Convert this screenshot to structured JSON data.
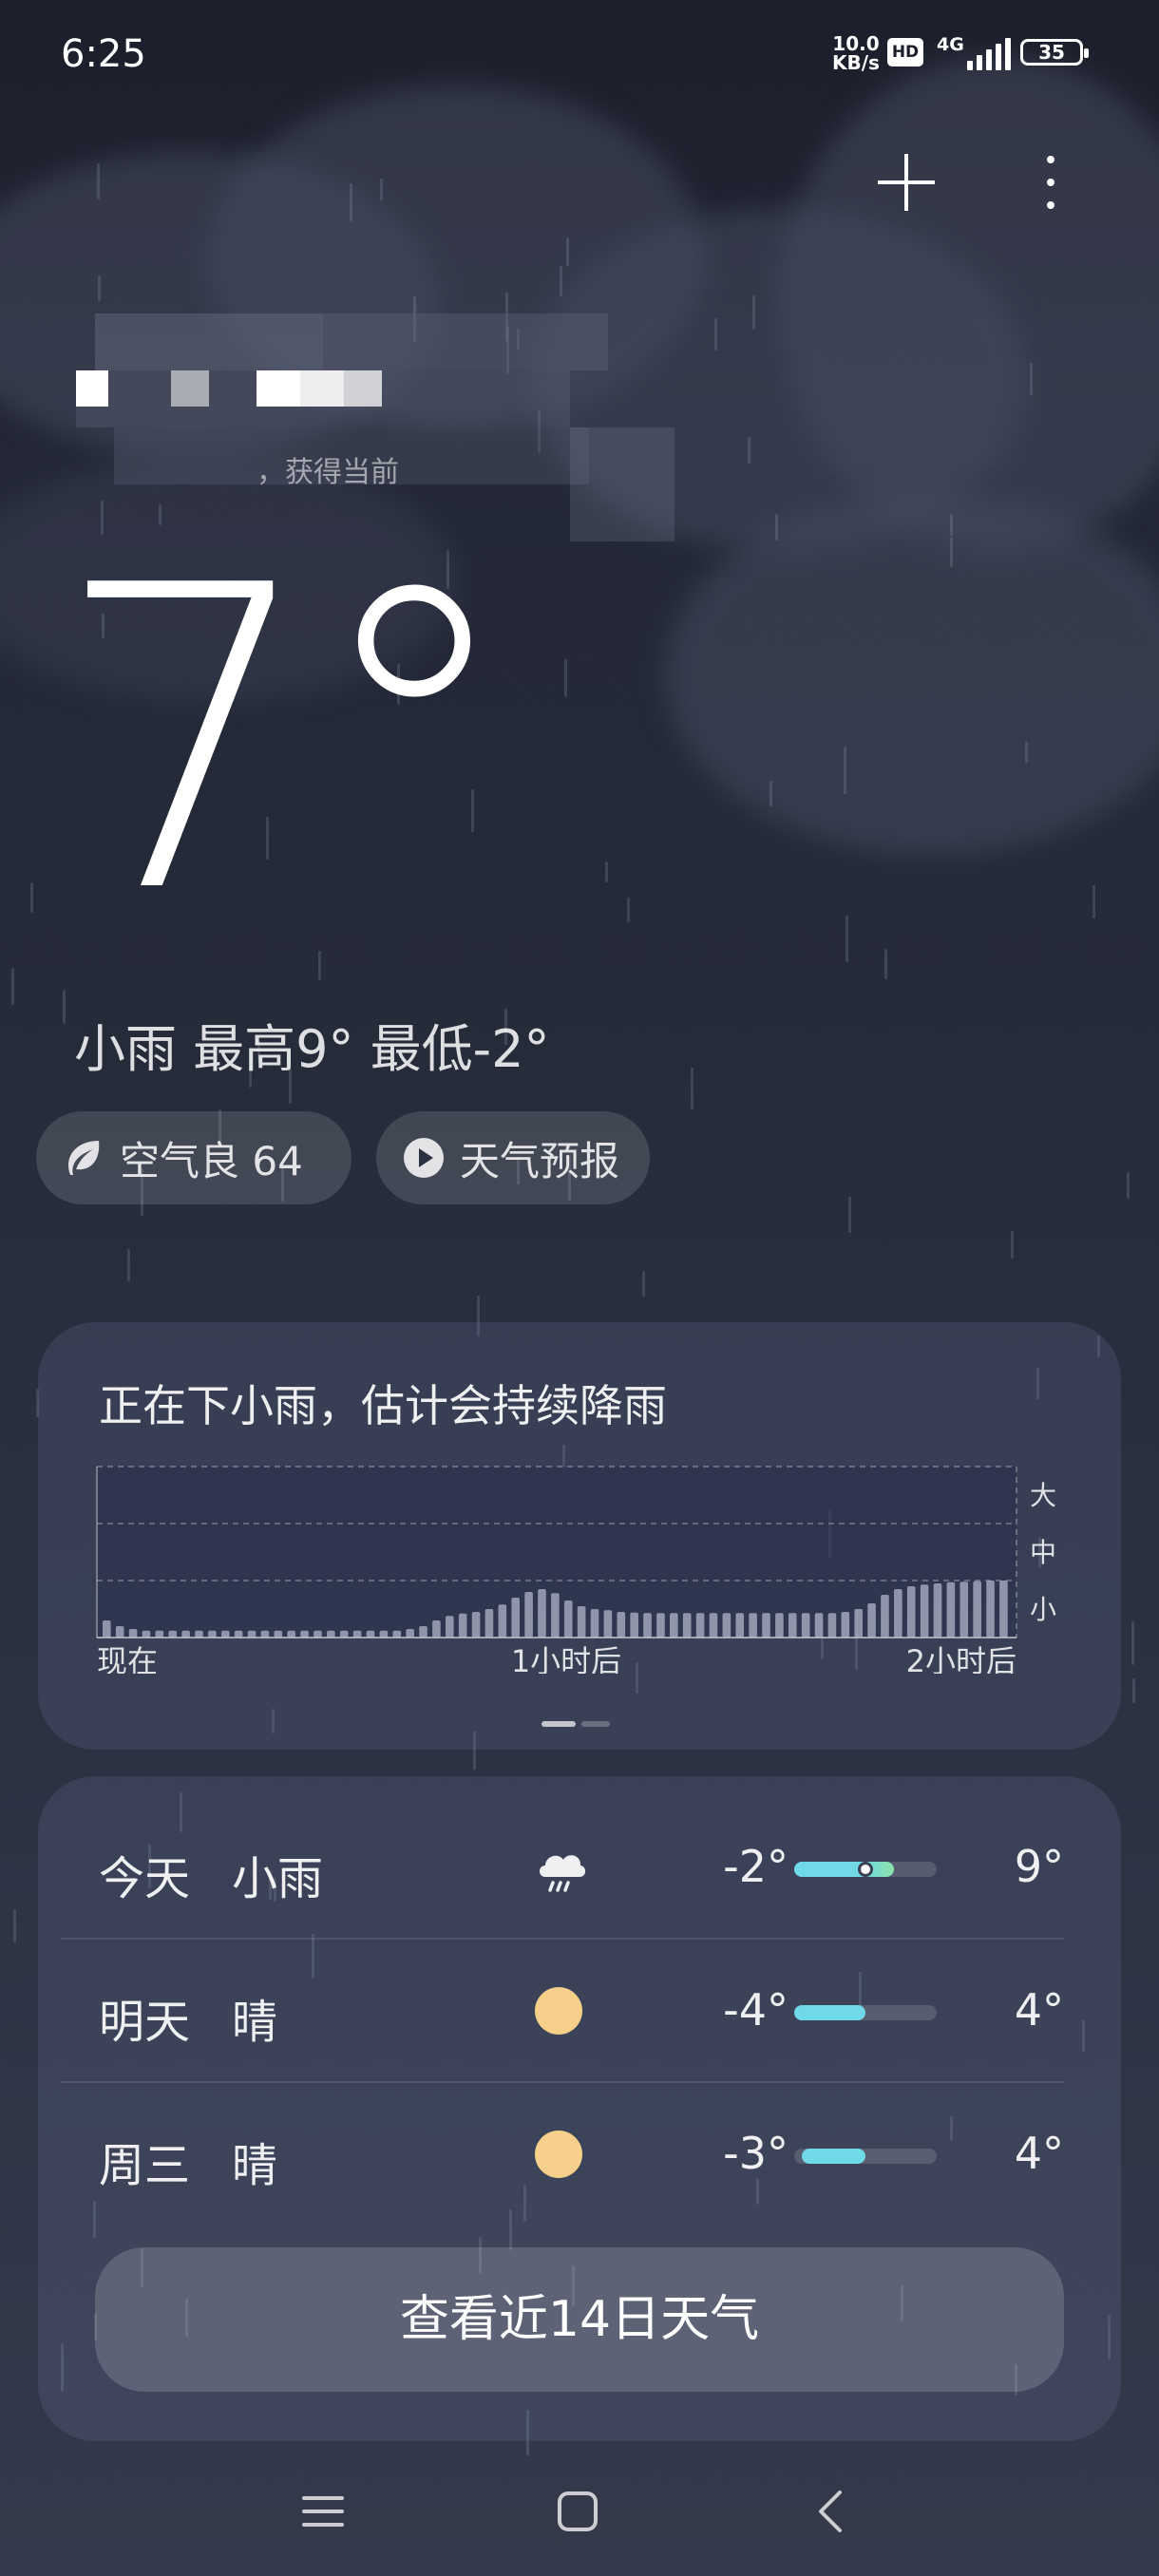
{
  "status_bar": {
    "time": "6:25",
    "net_speed_value": "10.0",
    "net_speed_unit": "KB/s",
    "hd_label": "HD",
    "network": "4G",
    "battery": "35"
  },
  "location": {
    "title": "者",
    "subtitle": "，获得当前"
  },
  "current": {
    "temperature": "7°",
    "summary": "小雨  最高9° 最低-2°"
  },
  "chips": {
    "air": "空气良 64",
    "forecast_video": "天气预报"
  },
  "rain_card": {
    "title": "正在下小雨，估计会持续降雨",
    "level_labels": [
      "大",
      "中",
      "小"
    ],
    "time_labels": [
      "现在",
      "1小时后",
      "2小时后"
    ]
  },
  "chart_data": {
    "type": "bar",
    "title": "正在下小雨，估计会持续降雨",
    "xlabel": "",
    "ylabel": "",
    "x_tick_labels": [
      "现在",
      "1小时后",
      "2小时后"
    ],
    "y_tick_labels": [
      "小",
      "中",
      "大"
    ],
    "ylim": [
      0,
      3
    ],
    "values": [
      0.3,
      0.2,
      0.15,
      0.12,
      0.12,
      0.12,
      0.12,
      0.12,
      0.12,
      0.12,
      0.12,
      0.12,
      0.12,
      0.12,
      0.12,
      0.12,
      0.12,
      0.12,
      0.12,
      0.12,
      0.12,
      0.12,
      0.12,
      0.15,
      0.2,
      0.3,
      0.38,
      0.42,
      0.45,
      0.5,
      0.58,
      0.7,
      0.8,
      0.85,
      0.78,
      0.65,
      0.55,
      0.5,
      0.48,
      0.45,
      0.44,
      0.43,
      0.43,
      0.43,
      0.43,
      0.43,
      0.43,
      0.43,
      0.43,
      0.43,
      0.43,
      0.43,
      0.43,
      0.43,
      0.43,
      0.43,
      0.45,
      0.5,
      0.6,
      0.75,
      0.85,
      0.9,
      0.93,
      0.95,
      0.97,
      0.98,
      0.99,
      1.0,
      1.0
    ]
  },
  "daily": [
    {
      "day": "今天",
      "condition": "小雨",
      "icon": "rain-cloud-icon",
      "low": "-2°",
      "high": "9°",
      "range_start": 0.0,
      "range_end": 0.7,
      "current_marker": 0.5
    },
    {
      "day": "明天",
      "condition": "晴",
      "icon": "sun-icon",
      "low": "-4°",
      "high": "4°",
      "range_start": 0.0,
      "range_end": 0.5
    },
    {
      "day": "周三",
      "condition": "晴",
      "icon": "sun-icon",
      "low": "-3°",
      "high": "4°",
      "range_start": 0.05,
      "range_end": 0.5
    }
  ],
  "view_14_days": "查看近14日天气",
  "colors": {
    "range_fill": "#6fd9e8",
    "range_fill_today_end": "#8fe3a8",
    "sun": "#f6d08a"
  }
}
